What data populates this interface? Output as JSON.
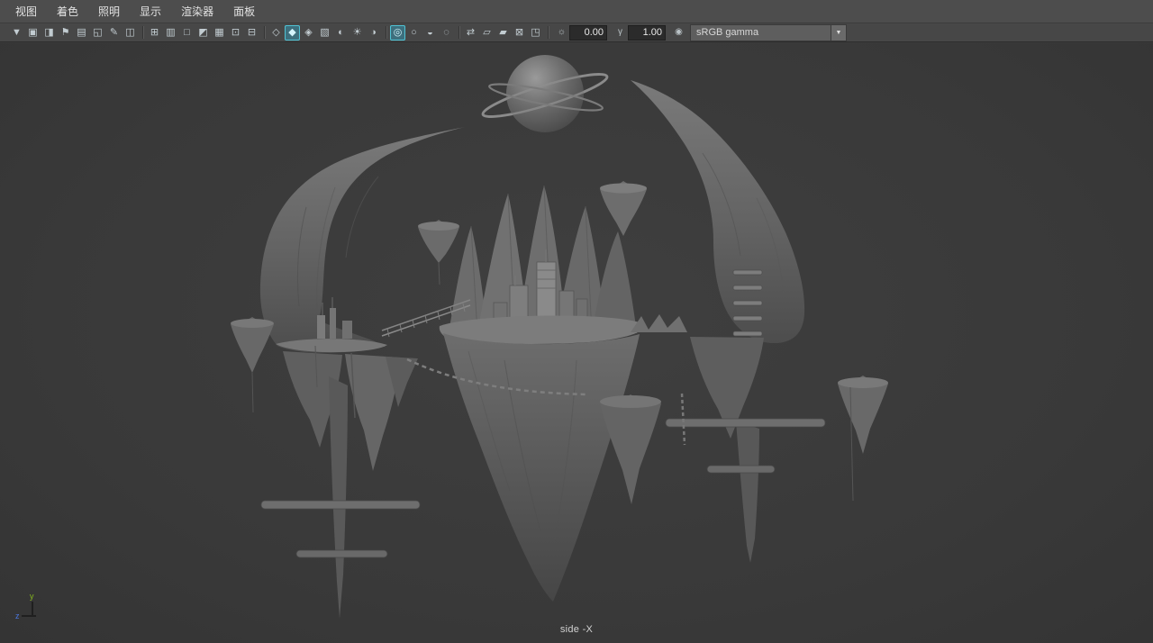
{
  "menubar": {
    "items": [
      {
        "id": "view",
        "label": "视图"
      },
      {
        "id": "shading",
        "label": "着色"
      },
      {
        "id": "lighting",
        "label": "照明"
      },
      {
        "id": "show",
        "label": "显示"
      },
      {
        "id": "renderer",
        "label": "渲染器"
      },
      {
        "id": "panels",
        "label": "面板"
      }
    ]
  },
  "toolbar": {
    "groups": [
      {
        "name": "camera-tools",
        "icons": [
          {
            "name": "select-camera-icon",
            "glyph": "▼"
          },
          {
            "name": "lock-camera-icon",
            "glyph": "▣"
          },
          {
            "name": "camera-attributes-icon",
            "glyph": "◨"
          },
          {
            "name": "bookmark-icon",
            "glyph": "⚑"
          },
          {
            "name": "image-plane-icon",
            "glyph": "▤"
          },
          {
            "name": "two-d-pan-zoom-icon",
            "glyph": "◱"
          },
          {
            "name": "grease-pencil-icon",
            "glyph": "✎"
          },
          {
            "name": "snapshot-icon",
            "glyph": "◫"
          }
        ]
      },
      {
        "name": "gates",
        "icons": [
          {
            "name": "grid-icon",
            "glyph": "⊞"
          },
          {
            "name": "film-gate-icon",
            "glyph": "▥"
          },
          {
            "name": "resolution-gate-icon",
            "glyph": "□"
          },
          {
            "name": "gate-mask-icon",
            "glyph": "◩"
          },
          {
            "name": "field-chart-icon",
            "glyph": "▦"
          },
          {
            "name": "safe-action-icon",
            "glyph": "⊡"
          },
          {
            "name": "safe-title-icon",
            "glyph": "⊟"
          }
        ]
      },
      {
        "name": "shading-modes",
        "icons": [
          {
            "name": "wireframe-icon",
            "glyph": "◇"
          },
          {
            "name": "smooth-shade-icon",
            "glyph": "◆",
            "active": true
          },
          {
            "name": "wireframe-on-shaded-icon",
            "glyph": "◈"
          },
          {
            "name": "textured-icon",
            "glyph": "▧"
          },
          {
            "name": "use-default-material-icon",
            "glyph": "◐"
          },
          {
            "name": "lighting-icon",
            "glyph": "☀"
          },
          {
            "name": "shadows-icon",
            "glyph": "◑"
          }
        ]
      },
      {
        "name": "display-options",
        "icons": [
          {
            "name": "isolate-select-icon",
            "glyph": "◎",
            "active": true
          },
          {
            "name": "xray-icon",
            "glyph": "○"
          },
          {
            "name": "ambient-occlusion-icon",
            "glyph": "◒"
          },
          {
            "name": "motion-blur-icon",
            "glyph": "◌"
          }
        ]
      },
      {
        "name": "view-buffers",
        "icons": [
          {
            "name": "swap-buffers-icon",
            "glyph": "⇄"
          },
          {
            "name": "copy-view-icon",
            "glyph": "▱"
          },
          {
            "name": "paste-view-icon",
            "glyph": "▰"
          },
          {
            "name": "greased-frames-icon",
            "glyph": "⊠"
          },
          {
            "name": "heads-up-display-icon",
            "glyph": "◳"
          }
        ]
      }
    ],
    "exposure": {
      "icon_glyph": "☼",
      "value": "0.00"
    },
    "gamma": {
      "icon_glyph": "γ",
      "value": "1.00"
    },
    "view_transform": {
      "icon_glyph": "◉"
    },
    "colorspace": {
      "value": "sRGB gamma",
      "chevron": "▼"
    }
  },
  "viewport": {
    "label": "side -X",
    "axis": {
      "y": "y",
      "z": "z"
    }
  },
  "colors": {
    "accent_teal": "#4fc3d4",
    "chrome_bg": "#4d4d4d",
    "viewport_bg": "#3a3a3a",
    "field_bg": "#2b2b2b",
    "axis_y_green": "#86b81f",
    "axis_z_blue": "#4a77e0"
  }
}
